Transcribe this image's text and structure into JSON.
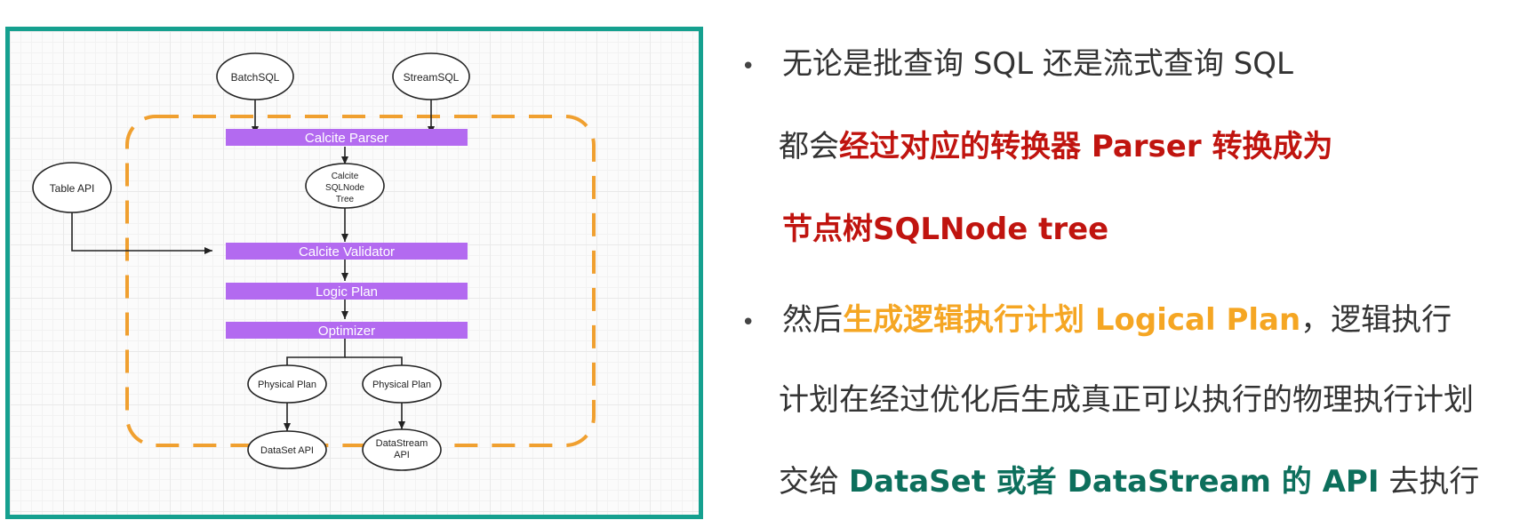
{
  "diagram": {
    "nodes": {
      "batch_sql": "BatchSQL",
      "stream_sql": "StreamSQL",
      "table_api": "Table API",
      "sqlnode_tree": [
        "Calcite",
        "SQLNode",
        "Tree"
      ],
      "physical_plan_1": "Physical Plan",
      "physical_plan_2": "Physical Plan",
      "dataset_api": "DataSet API",
      "datastream_api": [
        "DataStream",
        "API"
      ]
    },
    "bars": {
      "parser": "Calcite Parser",
      "validator": "Calcite Validator",
      "logic_plan": "Logic Plan",
      "optimizer": "Optimizer"
    },
    "colors": {
      "frame": "#15a08f",
      "bar": "#b36af0",
      "dashed_box": "#f0a030"
    }
  },
  "bullets": {
    "b1": {
      "l1": "无论是批查询 SQL 还是流式查询 SQL",
      "l2_a": "都会",
      "l2_b": "经过对应的转换器 Parser 转换成为",
      "l3": "节点树SQLNode tree"
    },
    "b2": {
      "l1_a": "然后",
      "l1_b": "生成逻辑执行计划 Logical Plan",
      "l1_c": "，逻辑执行",
      "l2": "计划在经过优化后生成真正可以执行的物理执行计划",
      "l3_a": "交给 ",
      "l3_b": "DataSet 或者 DataStream 的 API",
      "l3_c": " 去执行"
    },
    "colors": {
      "red": "#c0140f",
      "orange": "#f5a623",
      "green": "#0d6f5c"
    }
  }
}
